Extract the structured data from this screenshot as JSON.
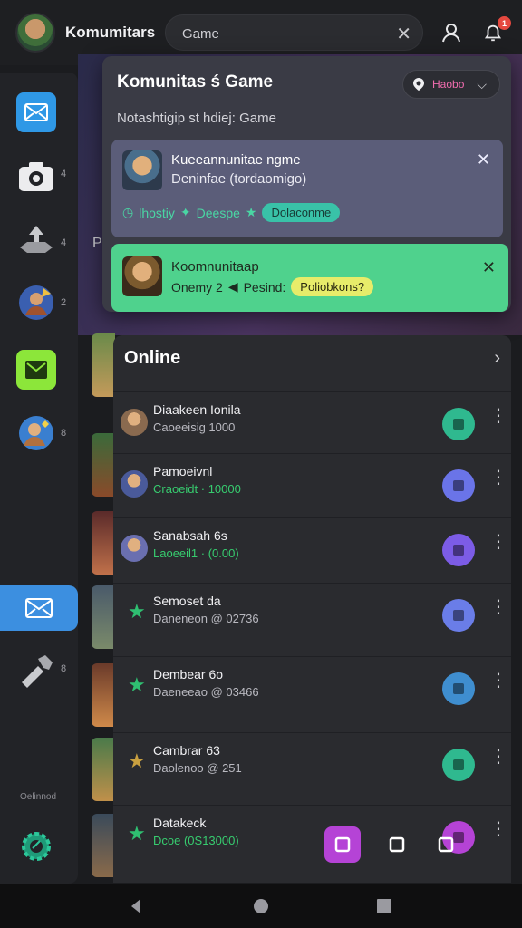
{
  "header": {
    "app_title": "Komumitars",
    "search": {
      "value": "Game",
      "placeholder": ""
    },
    "notification_count": "1"
  },
  "rail": {
    "counts": [
      "4",
      "4",
      "2",
      "8",
      "8"
    ],
    "footer_label": "Oelinnod"
  },
  "hero": {
    "partial_text": "P"
  },
  "panel": {
    "title": "Komunitas ś Game",
    "subtitle": "Notashtigip st hdiej: Game",
    "region_label": "Haobo",
    "card1": {
      "title": "Kueeannunitae ngme",
      "subtitle": "Deninfae (tordaomigo)",
      "tags": [
        "lhostiy",
        "Deespe"
      ],
      "pill": "Dolaconme"
    },
    "card2": {
      "title": "Koomnunitaap",
      "subtitle": "Onemy 2",
      "extra": "Pesind:",
      "pill": "Poliobkons?"
    }
  },
  "online": {
    "title": "Online",
    "members": [
      {
        "name": "Diaakeen Ionila",
        "status": "Caoeeisig 1000",
        "status_color": "#b9b9c0",
        "action_color": "#2fb98f",
        "kind": "avatar",
        "avatar_color": "#8a6a4f"
      },
      {
        "name": "Pamoeivnl",
        "status": "Craoeidt · 10000",
        "status_color": "#37cc6f",
        "action_color": "#6a74e8",
        "kind": "avatar",
        "avatar_color": "#4a5a9a"
      },
      {
        "name": "Sanabsah 6s",
        "status": "Laoeeil1 · (0.00)",
        "status_color": "#37cc6f",
        "action_color": "#7c5ce6",
        "kind": "avatar",
        "avatar_color": "#6a6fb0"
      },
      {
        "name": "Semoset da",
        "status": "Daneneon @ 02736",
        "status_color": "#b9b9c0",
        "action_color": "#6a7de8",
        "kind": "star",
        "avatar_color": "#2fbf71"
      },
      {
        "name": "Dembear 6o",
        "status": "Daeneeao @ 03466",
        "status_color": "#b9b9c0",
        "action_color": "#3f8ecf",
        "kind": "star",
        "avatar_color": "#2fbf71"
      },
      {
        "name": "Cambrar 63",
        "status": "Daolenoo @ 251",
        "status_color": "#b9b9c0",
        "action_color": "#2fb98f",
        "kind": "star",
        "avatar_color": "#c9a040"
      },
      {
        "name": "Datakeck",
        "status": "Dcoe (0S13000)",
        "status_color": "#37cc6f",
        "action_color": "#b543d6",
        "kind": "star",
        "avatar_color": "#2fbf71"
      }
    ]
  },
  "colors": {
    "accent_blue": "#3c8fe0",
    "green": "#4fd28d",
    "panel": "#3a3b45"
  }
}
